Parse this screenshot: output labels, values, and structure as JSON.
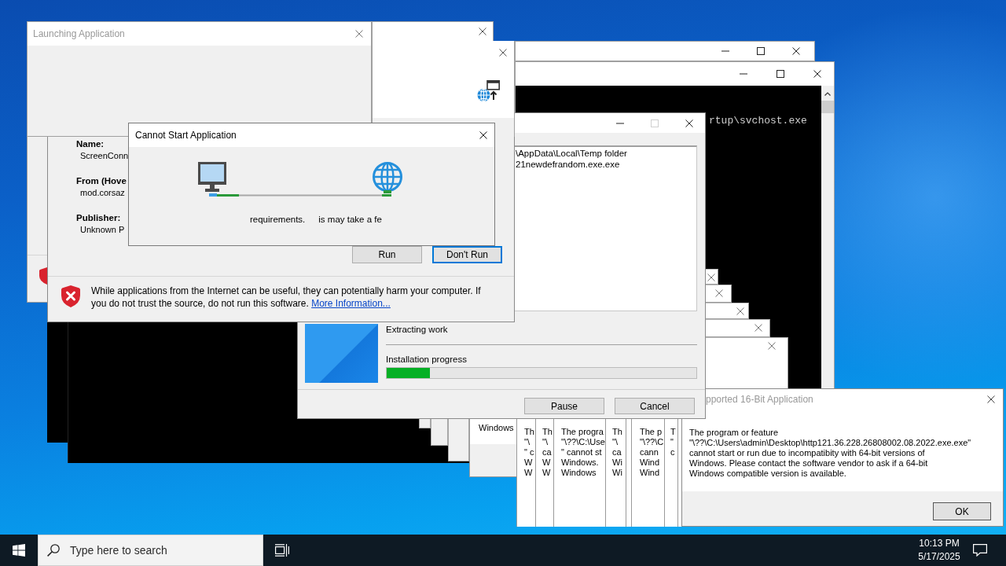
{
  "launching_window": {
    "title": "Launching Application",
    "active": false
  },
  "security_warning": {
    "fields": [
      {
        "label": "Name:",
        "value": "ScreenConn"
      },
      {
        "label": "From (Hove",
        "value": "mod.corsaz"
      },
      {
        "label": "Publisher:",
        "value": "Unknown P"
      }
    ],
    "buttons": [
      {
        "label": "Run",
        "default": false
      },
      {
        "label": "Don't Run",
        "default": true
      }
    ],
    "warning": "While applications from the Internet can be useful, they can potentially harm your computer. If you do not trust the source, do not run this software.",
    "link": "More Information..."
  },
  "cannot_start_dialog": {
    "title": "Cannot Start Application",
    "active": true,
    "status_texts": [
      "requirements.",
      "is may take a fe"
    ]
  },
  "console_window": {
    "output_line": "rtup\\svchost.exe"
  },
  "installer_window": {
    "maximize_disabled": true,
    "log_lines": [
      "\\AppData\\Local\\Temp folder",
      "21newdefrandom.exe.exe"
    ],
    "status": "Extracting work",
    "progress_label": "Installation progress",
    "progress": {
      "level": 0.14
    },
    "buttons": [
      "Pause",
      "Cancel"
    ]
  },
  "partial_dialog": {
    "text": "Windows"
  },
  "stacked_dialogs": [
    {
      "lines": [
        "Th",
        "\"\\",
        "\" c",
        "W",
        "W"
      ]
    },
    {
      "lines": [
        "Th",
        "\"\\",
        "ca",
        "W",
        "W"
      ]
    },
    {
      "lines": [
        "The progra",
        "\"\\??\\C:\\Use",
        "\" cannot st",
        "Windows.",
        "Windows"
      ]
    },
    {
      "lines": [
        "Th",
        "\"\\",
        "ca",
        "Wi",
        "Wi"
      ]
    },
    {
      "lines": [
        "The p",
        "\"\\??\\C",
        "cann",
        "Wind",
        "Wind"
      ]
    },
    {
      "lines": [
        "T",
        "\"",
        "c"
      ]
    }
  ],
  "error_dialog": {
    "title": "pported 16-Bit Application",
    "active": false,
    "message": "The program or feature\n\"\\??\\C:\\Users\\admin\\Desktop\\http121.36.228.26808002.08.2022.exe.exe\"\ncannot start or run due to incompatibity with 64-bit versions of\nWindows. Please contact the software vendor to ask if a 64-bit\nWindows compatible version is available.",
    "button": "OK"
  },
  "taskbar": {
    "search_placeholder": "Type here to search",
    "time": "10:13 PM",
    "date": "5/17/2025"
  }
}
